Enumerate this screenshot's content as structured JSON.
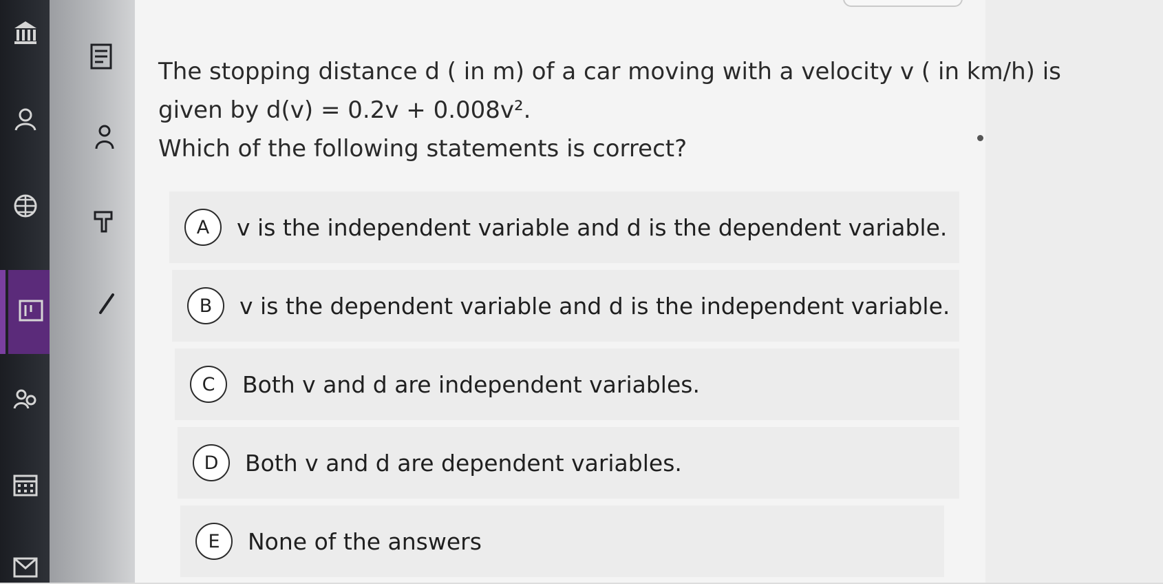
{
  "question": {
    "line1": "The stopping distance d ( in m) of a car moving with a velocity v ( in km/h) is",
    "line2": "given by d(v) = 0.2v + 0.008v².",
    "line3": "Which of the following statements is correct?"
  },
  "answers": [
    {
      "letter": "A",
      "text": "v is the independent variable and d is the dependent variable."
    },
    {
      "letter": "B",
      "text": "v is the dependent variable and d is the independent variable."
    },
    {
      "letter": "C",
      "text": "Both v and d are independent variables."
    },
    {
      "letter": "D",
      "text": "Both v and d are dependent variables."
    },
    {
      "letter": "E",
      "text": "None of the answers"
    }
  ],
  "rail_icons": [
    "institution-icon",
    "profile-icon",
    "globe-icon",
    "calendar-grid-icon",
    "inbox-icon"
  ],
  "strip_icons": [
    "course-icon",
    "people-icon",
    "pin-icon",
    "edit-icon"
  ],
  "colors": {
    "accent": "#5b2b7a"
  }
}
